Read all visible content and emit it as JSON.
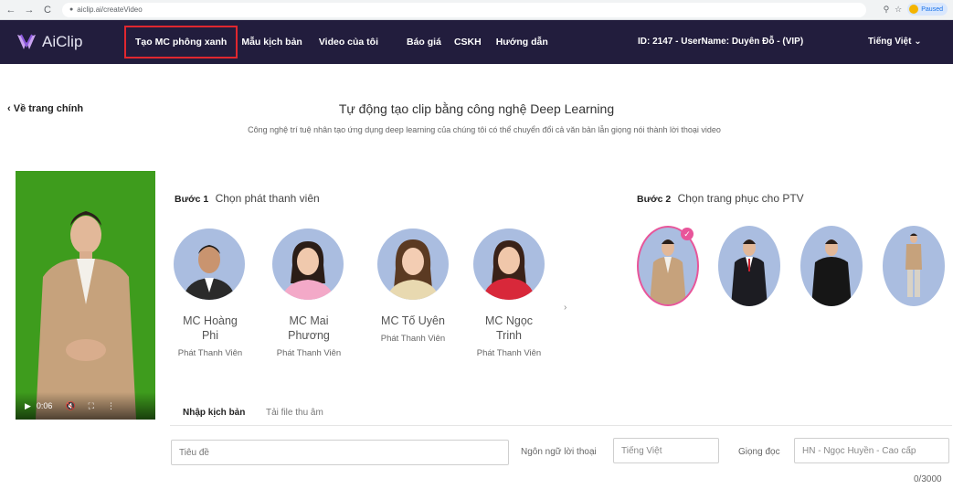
{
  "browser": {
    "url": "aiclip.ai/createVideo",
    "profile_status": "Paused"
  },
  "app": {
    "logo_text": "AiClip",
    "nav": [
      {
        "label": "Tạo MC phông xanh"
      },
      {
        "label": "Mẫu kịch bản"
      },
      {
        "label": "Video của tôi"
      },
      {
        "label": "Báo giá"
      },
      {
        "label": "CSKH"
      },
      {
        "label": "Hướng dẫn"
      }
    ],
    "user_info": "ID: 2147 - UserName: Duyên Đỗ - (VIP)",
    "language": "Tiếng Việt"
  },
  "page": {
    "back_link": "Về trang chính",
    "heading": "Tự động tạo clip bằng công nghệ Deep Learning",
    "subheading": "Công nghệ trí tuệ nhân tạo ứng dụng deep learning của chúng tôi có thể chuyển đổi cả văn bản lẫn giọng nói thành lời thoại video"
  },
  "video": {
    "time": "0:06"
  },
  "step1": {
    "label": "Bước 1",
    "title": "Chọn phát thanh viên",
    "mcs": [
      {
        "name_line1": "MC Hoàng",
        "name_line2": "Phi",
        "role": "Phát Thanh Viên"
      },
      {
        "name_line1": "MC Mai",
        "name_line2": "Phương",
        "role": "Phát Thanh Viên"
      },
      {
        "name_line1": "MC Tố Uyên",
        "name_line2": "",
        "role": "Phát Thanh Viên"
      },
      {
        "name_line1": "MC Ngọc",
        "name_line2": "Trinh",
        "role": "Phát Thanh Viên"
      }
    ],
    "next_arrow": "›"
  },
  "step2": {
    "label": "Bước 2",
    "title": "Chọn trang phục cho PTV",
    "selected_outfit_index": 0
  },
  "tabs": [
    {
      "label": "Nhập kịch bản"
    },
    {
      "label": "Tải file thu âm"
    }
  ],
  "form": {
    "title_placeholder": "Tiêu đề",
    "language_label": "Ngôn ngữ lời thoại",
    "language_value": "Tiếng Việt",
    "voice_label": "Giọng đọc",
    "voice_value": "HN - Ngọc Huyền - Cao cấp",
    "char_counter": "0/3000"
  },
  "colors": {
    "nav_bg": "#221d3d",
    "active_border": "#e0272f",
    "green_screen": "#3e9c1d",
    "avatar_bg": "#aabde0",
    "selected_pink": "#e8559a"
  }
}
